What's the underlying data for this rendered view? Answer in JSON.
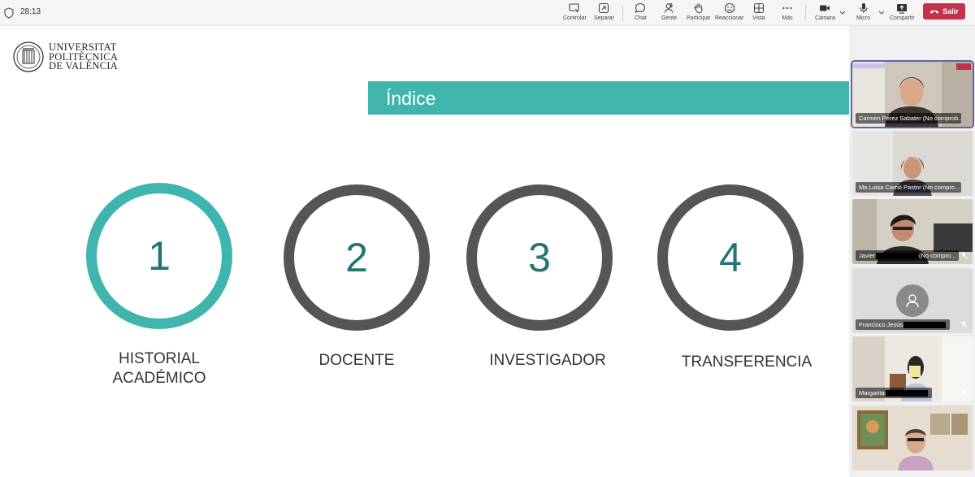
{
  "toolbar": {
    "timer": "28:13",
    "buttons": {
      "control": "Controlar",
      "separate": "Separar",
      "chat": "Chat",
      "people": "Gente",
      "people_count": "6",
      "raise_hand": "Participar",
      "react": "Reaccionar",
      "view": "Vista",
      "more": "Más",
      "camera": "Cámara",
      "mic": "Micro",
      "share": "Compartir",
      "leave": "Salir"
    }
  },
  "slide": {
    "logo": {
      "line1": "UNIVERSITAT",
      "line2": "POLITÈCNICA",
      "line3": "DE VALÈNCIA"
    },
    "title": "Índice",
    "sections": [
      {
        "number": "1",
        "label_line1": "HISTORIAL",
        "label_line2": "ACADÉMICO",
        "color": "#3fb5ae"
      },
      {
        "number": "2",
        "label_line1": "DOCENTE",
        "color": "#555555"
      },
      {
        "number": "3",
        "label_line1": "INVESTIGADOR",
        "color": "#555555"
      },
      {
        "number": "4",
        "label_line1": "TRANSFERENCIA",
        "color": "#555555"
      }
    ]
  },
  "participants": [
    {
      "name": "Carmen Pérez Sabater (No comprob...",
      "active": true
    },
    {
      "name": "Ma Luisa Carrió Pastor (No compro..."
    },
    {
      "name_start": "Javier",
      "name_end": "(No compro...",
      "muted": true
    },
    {
      "name_start": "Francisco Jesús",
      "muted": true,
      "avatar": "person-icon"
    },
    {
      "name_start": "Margarita",
      "muted": true
    },
    {
      "name": ""
    }
  ],
  "colors": {
    "accent_teal": "#3fb5ae",
    "number_teal": "#247571",
    "ring_gray": "#555555",
    "leave_red": "#c4314b",
    "active_outline": "#6264a7"
  }
}
